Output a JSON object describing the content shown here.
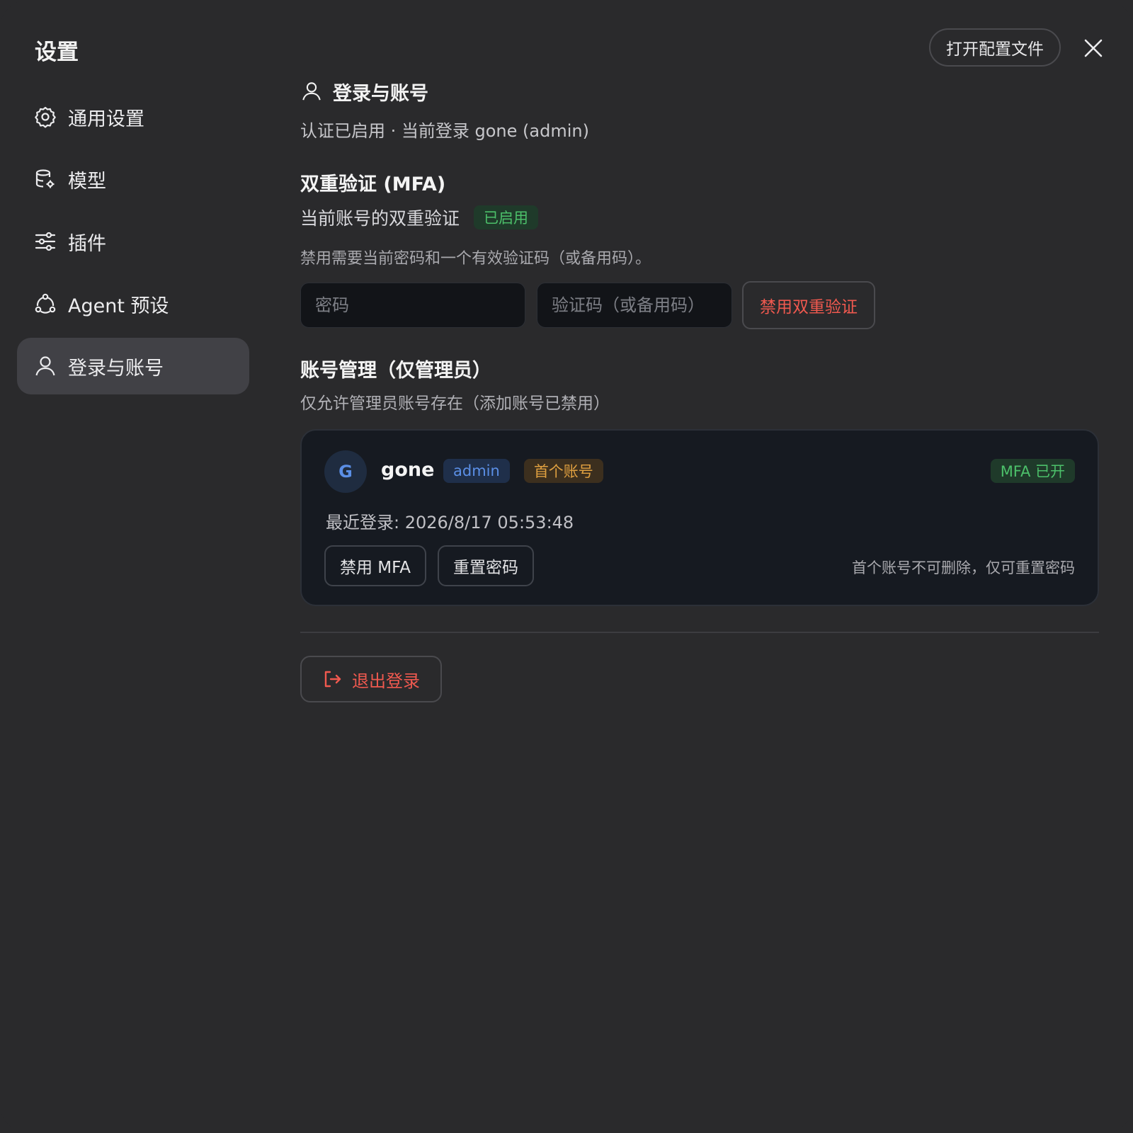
{
  "window": {
    "title": "设置",
    "config_button": "打开配置文件",
    "close_icon": "close-icon"
  },
  "sidebar": {
    "items": [
      {
        "label": "通用设置",
        "icon": "gear-icon",
        "active": false
      },
      {
        "label": "模型",
        "icon": "database-gear-icon",
        "active": false
      },
      {
        "label": "插件",
        "icon": "sliders-icon",
        "active": false
      },
      {
        "label": "Agent 预设",
        "icon": "agent-icon",
        "active": false
      },
      {
        "label": "登录与账号",
        "icon": "user-icon",
        "active": true
      }
    ]
  },
  "main": {
    "section_title": "登录与账号",
    "auth_status": "认证已启用 · 当前登录 gone (admin)",
    "mfa": {
      "title": "双重验证 (MFA)",
      "status_label": "当前账号的双重验证",
      "status_badge": "已启用",
      "hint": "禁用需要当前密码和一个有效验证码（或备用码）。",
      "password_placeholder": "密码",
      "code_placeholder": "验证码（或备用码）",
      "disable_button": "禁用双重验证"
    },
    "accounts": {
      "title": "账号管理（仅管理员）",
      "subtitle": "仅允许管理员账号存在（添加账号已禁用）",
      "items": [
        {
          "avatar_letter": "G",
          "name": "gone",
          "role_badge": "admin",
          "first_badge": "首个账号",
          "mfa_badge": "MFA 已开",
          "last_login": "最近登录: 2026/8/17 05:53:48",
          "disable_mfa_button": "禁用 MFA",
          "reset_password_button": "重置密码",
          "note": "首个账号不可删除，仅可重置密码"
        }
      ]
    },
    "logout_button": "退出登录"
  },
  "colors": {
    "background": "#2a2a2c",
    "active_nav": "#414146",
    "danger": "#f0594f",
    "success": "#4cc06a",
    "info": "#5b8fe6",
    "warning": "#e0a040"
  }
}
